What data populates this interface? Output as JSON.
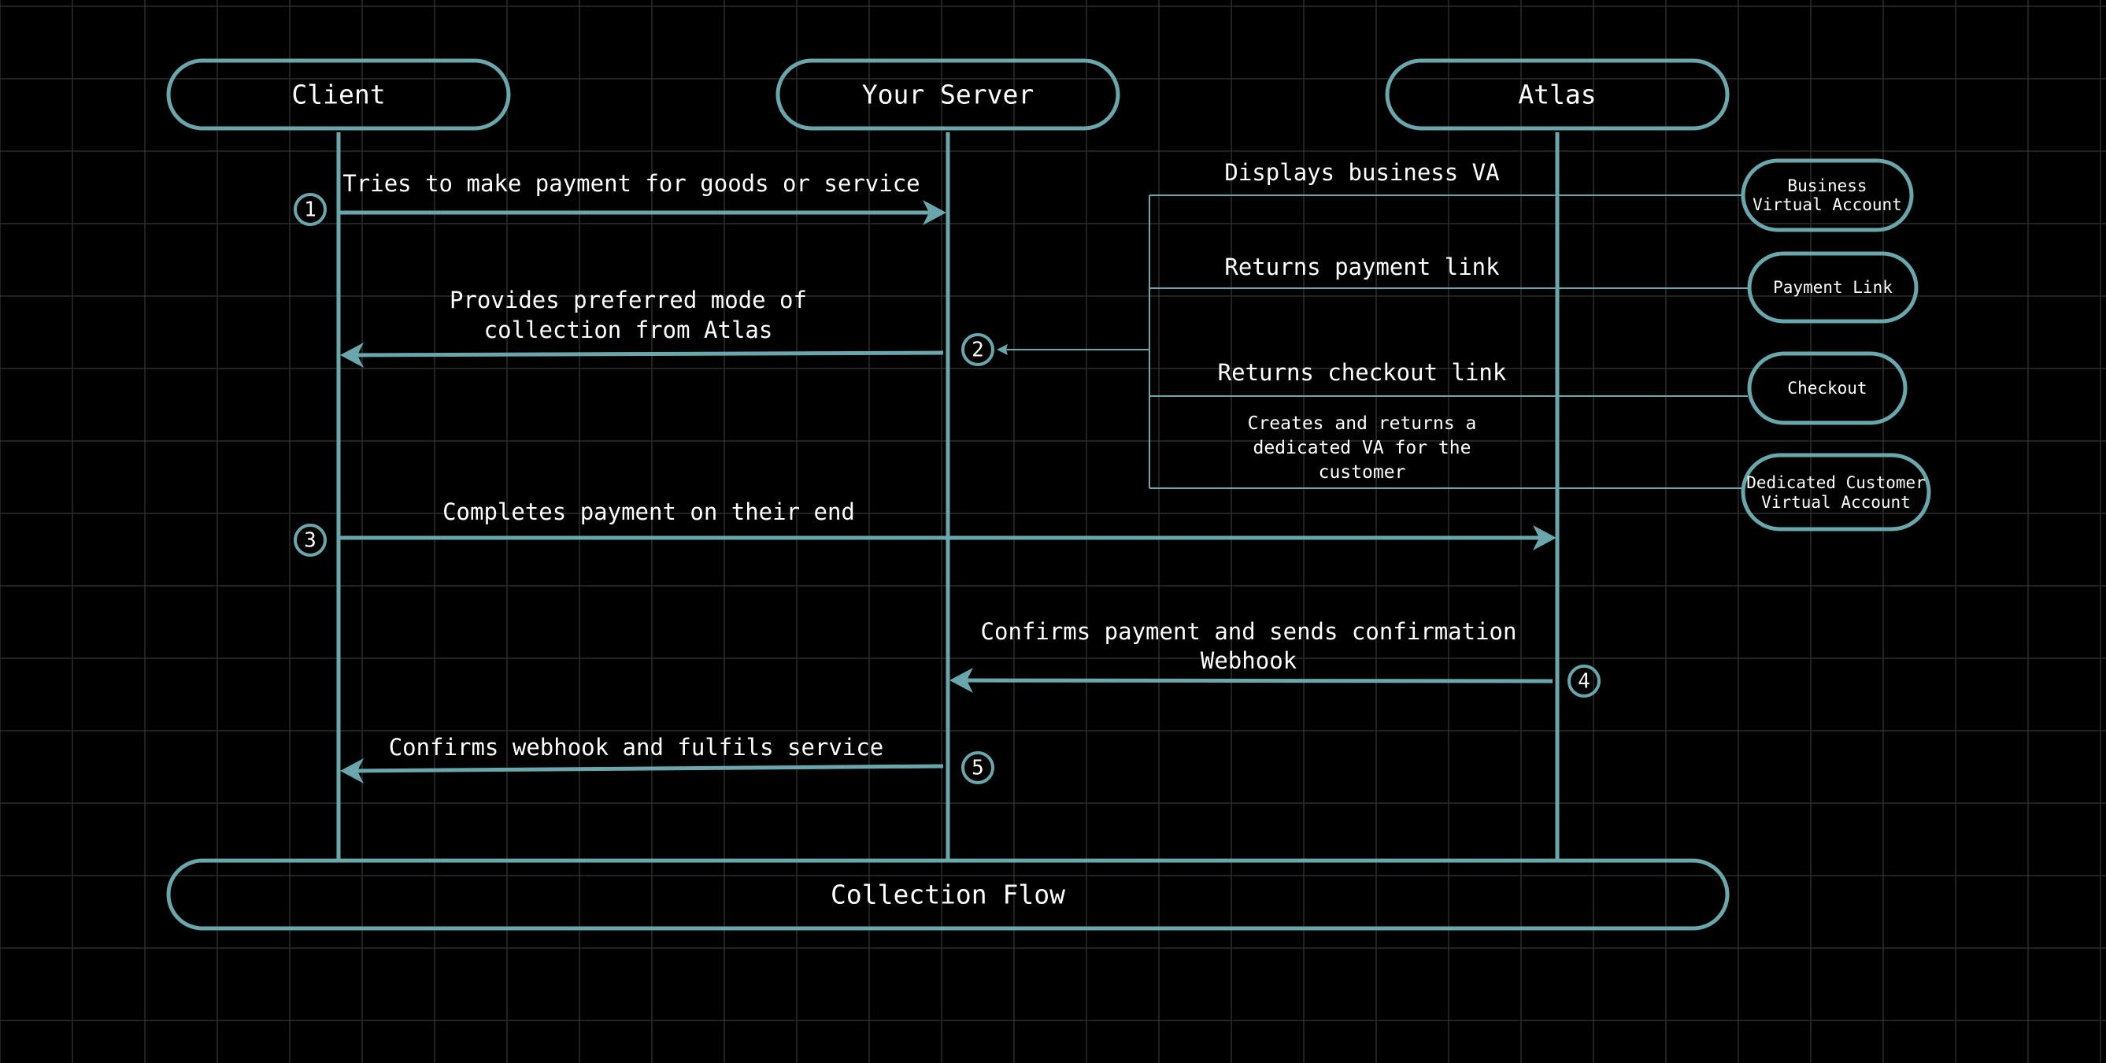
{
  "colors": {
    "background": "#000000",
    "grid": "#2e2e2e",
    "accent": "#6aa7ad",
    "text": "#ffffff"
  },
  "actors": {
    "client": "Client",
    "server": "Your Server",
    "atlas": "Atlas"
  },
  "footer": {
    "title": "Collection Flow"
  },
  "steps": {
    "s1": {
      "number": "1",
      "label": "Tries to make payment for goods or service"
    },
    "s2": {
      "number": "2",
      "line1": "Provides preferred mode of",
      "line2": "collection from Atlas"
    },
    "s3": {
      "number": "3",
      "label": "Completes payment on their end"
    },
    "s4": {
      "number": "4",
      "line1": "Confirms payment and sends confirmation",
      "line2": "Webhook"
    },
    "s5": {
      "number": "5",
      "label": "Confirms webhook and fulfils service"
    }
  },
  "options": {
    "business_va": "Displays business VA",
    "payment_link": "Returns payment link",
    "checkout": "Returns checkout link",
    "dedicated_line1": "Creates and returns a",
    "dedicated_line2": "dedicated VA for the",
    "dedicated_line3": "customer"
  },
  "side_nodes": {
    "business_line1": "Business",
    "business_line2": "Virtual Account",
    "payment_link": "Payment Link",
    "checkout": "Checkout",
    "dedicated_line1": "Dedicated Customer",
    "dedicated_line2": "Virtual Account"
  }
}
